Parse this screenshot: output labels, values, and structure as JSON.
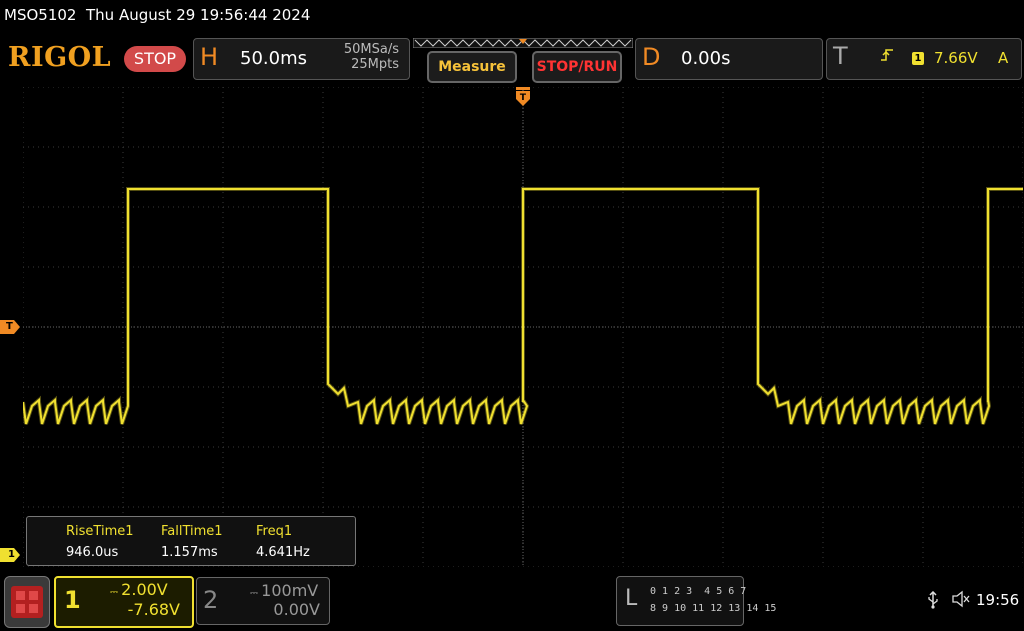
{
  "status_bar": {
    "model": "MSO5102",
    "datetime": "Thu August 29 19:56:44 2024"
  },
  "brand": {
    "logo": "RIGOL",
    "run_state": "STOP",
    "accent": "#f08a24"
  },
  "horizontal": {
    "letter": "H",
    "timebase": "50.0ms",
    "sample_rate": "50MSa/s",
    "memory_depth": "25Mpts"
  },
  "buttons": {
    "measure": "Measure",
    "stop_run": "STOP/RUN"
  },
  "delay": {
    "letter": "D",
    "value": "0.00s"
  },
  "trigger": {
    "letter": "T",
    "edge_icon": "rising-edge-icon",
    "source": "1",
    "level": "7.66V",
    "mode": "A"
  },
  "markers": {
    "trigger_level": "T",
    "ch1_ground": "1"
  },
  "measurements": [
    {
      "name": "RiseTime1",
      "value": "946.0us"
    },
    {
      "name": "FallTime1",
      "value": "1.157ms"
    },
    {
      "name": "Freq1",
      "value": "4.641Hz"
    }
  ],
  "channel1": {
    "number": "1",
    "scale": "2.00V",
    "offset": "-7.68V",
    "color": "#f0e030"
  },
  "channel2": {
    "number": "2",
    "scale": "100mV",
    "offset": "0.00V"
  },
  "logic": {
    "letter": "L",
    "row1": "0 1 2 3  4 5 6 7",
    "row2": "8 9 10 11 12 13 14 15"
  },
  "system": {
    "usb_icon": "usb-icon",
    "sound_icon": "speaker-muted-icon",
    "time": "19:56"
  },
  "waveform": {
    "high_level_div": 2.3,
    "low_level_div": -1.25,
    "segments_x": [
      {
        "from": 0.0,
        "to": 0.105,
        "state": "low"
      },
      {
        "from": 0.105,
        "to": 0.305,
        "state": "high"
      },
      {
        "from": 0.305,
        "to": 0.5,
        "state": "low"
      },
      {
        "from": 0.5,
        "to": 0.735,
        "state": "high"
      },
      {
        "from": 0.735,
        "to": 0.965,
        "state": "low"
      },
      {
        "from": 0.965,
        "to": 1.0,
        "state": "high"
      }
    ]
  }
}
